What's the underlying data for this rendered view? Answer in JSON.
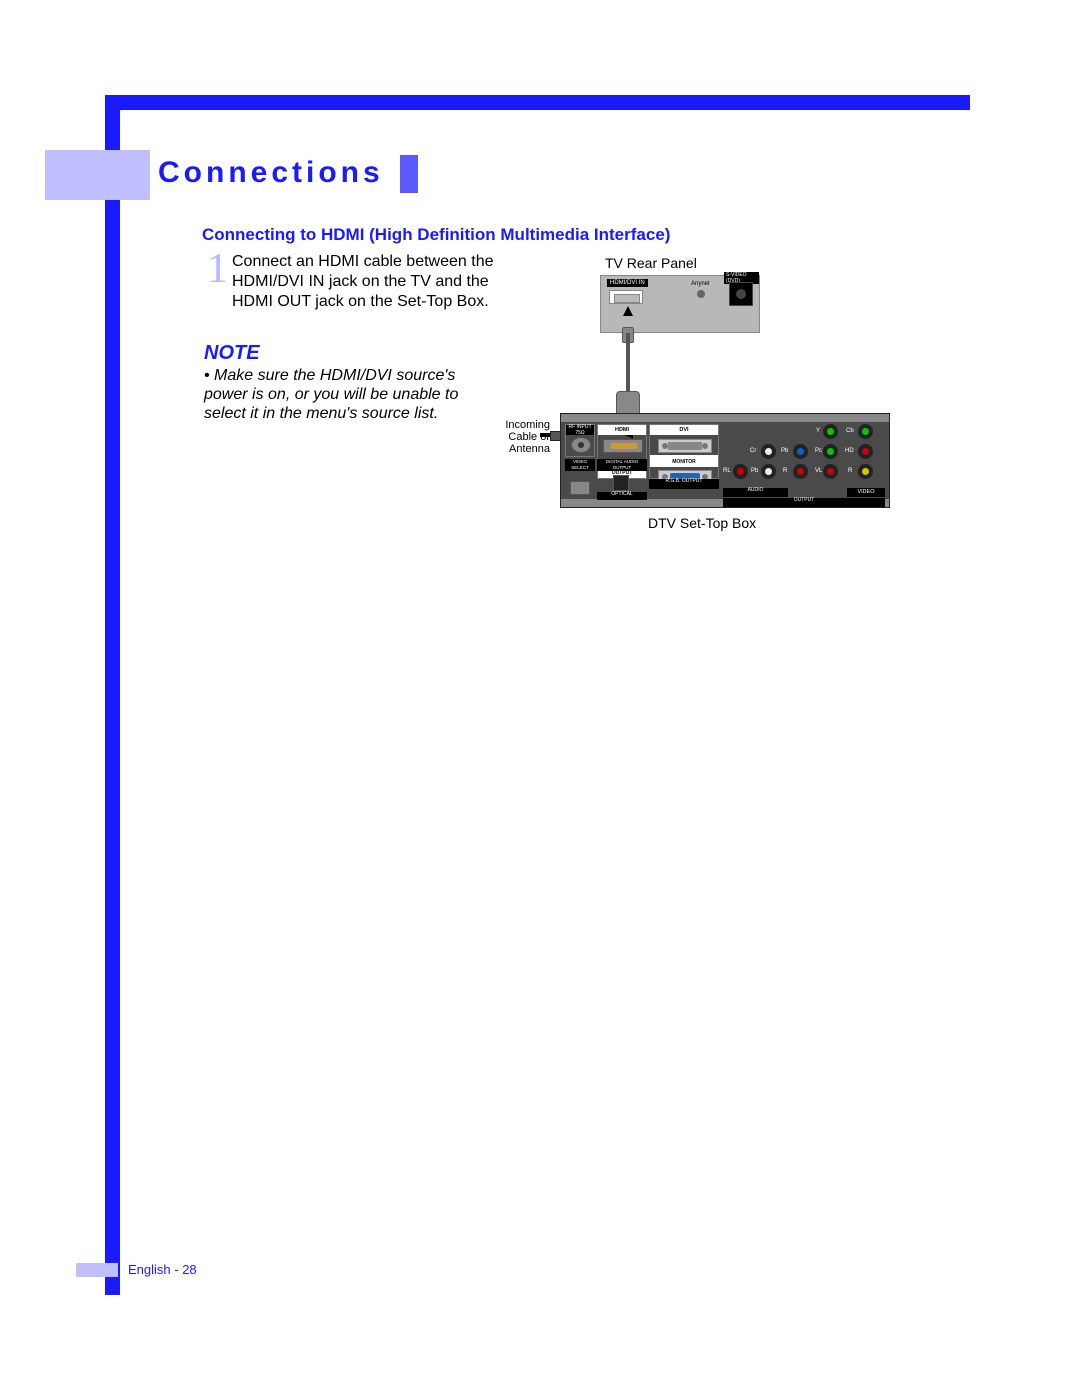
{
  "heading": "Connections",
  "sub_heading": "Connecting to HDMI (High Definition Multimedia Interface)",
  "step": {
    "num": "1",
    "text": "Connect an HDMI cable between the HDMI/DVI IN jack on the TV and the HDMI OUT jack on the Set-Top Box."
  },
  "note": {
    "heading": "NOTE",
    "bullet": "• Make sure the HDMI/DVI source's power is on, or you will be unable to select it in the menu's source list."
  },
  "diagram": {
    "tv_label": "TV Rear Panel",
    "stb_label": "DTV Set-Top Box",
    "incoming_label": "Incoming\nCable or\nAntenna",
    "tv_panel": {
      "hdmi_in": "HDMI/DVI IN",
      "anynet": "Anynet",
      "svideo": "S-VIDEO (DVD)"
    },
    "stb_panel": {
      "rf_input": "RF INPUT 75Ω",
      "hdmi": "HDMI",
      "dvi": "DVI",
      "output": "OUTPUT",
      "monitor": "MONITOR",
      "rgb_output": "R.G.B. OUTPUT",
      "video_select": "VIDEO SELECT",
      "dao": "DIGITAL AUDIO OUTPUT",
      "optical": "OPTICAL",
      "audio": "AUDIO",
      "video": "VIDEO",
      "output2": "OUTPUT",
      "ports": {
        "y": "Y",
        "cb": "Cb",
        "cr": "Cr",
        "pb": "Pb",
        "pc": "Pc",
        "hd": "HD",
        "rl": "RL",
        "rr": "R",
        "vl": "VL",
        "vr": "R"
      }
    }
  },
  "footer": "English - 28"
}
